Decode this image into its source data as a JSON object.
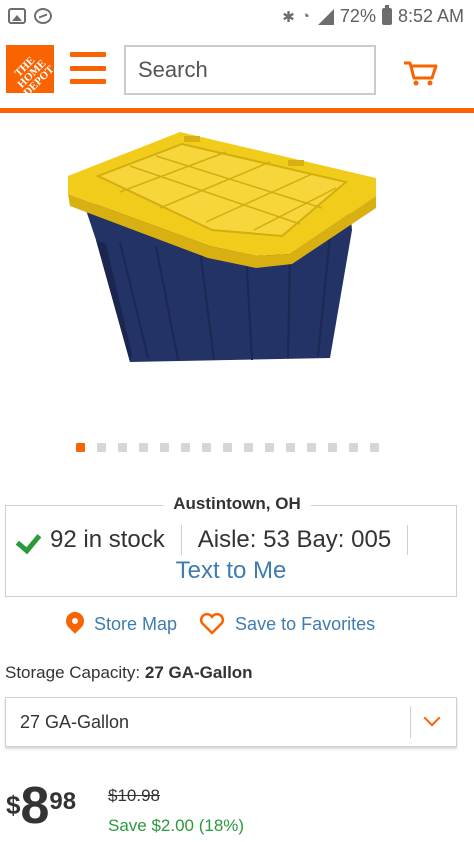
{
  "status_bar": {
    "battery": "72%",
    "time": "8:52 AM",
    "icons": [
      "image-icon",
      "messenger-icon",
      "bluetooth-icon",
      "wifi-icon",
      "signal-icon",
      "battery-icon"
    ]
  },
  "header": {
    "logo_text": "THE HOME DEPOT",
    "menu_icon": "hamburger-icon",
    "search_placeholder": "Search",
    "search_icon": "search-icon",
    "cart_icon": "cart-icon",
    "accent_color": "#f96302"
  },
  "gallery": {
    "total_images": 15,
    "active_index": 0,
    "image_description_icon": "storage-tote-image"
  },
  "store": {
    "name": "Austintown, OH",
    "stock": "92 in stock",
    "location": "Aisle: 53 Bay: 005",
    "text_to_me": "Text to Me"
  },
  "links": {
    "store_map": "Store Map",
    "save_favorites": "Save to Favorites"
  },
  "option": {
    "label": "Storage Capacity:",
    "value": "27 GA-Gallon",
    "selected": "27 GA-Gallon"
  },
  "pricing": {
    "currency": "$",
    "dollars": "8",
    "cents": "98",
    "was_price": "$10.98",
    "savings": "Save $2.00 (18%)",
    "savings_color": "#2a9a3a"
  }
}
